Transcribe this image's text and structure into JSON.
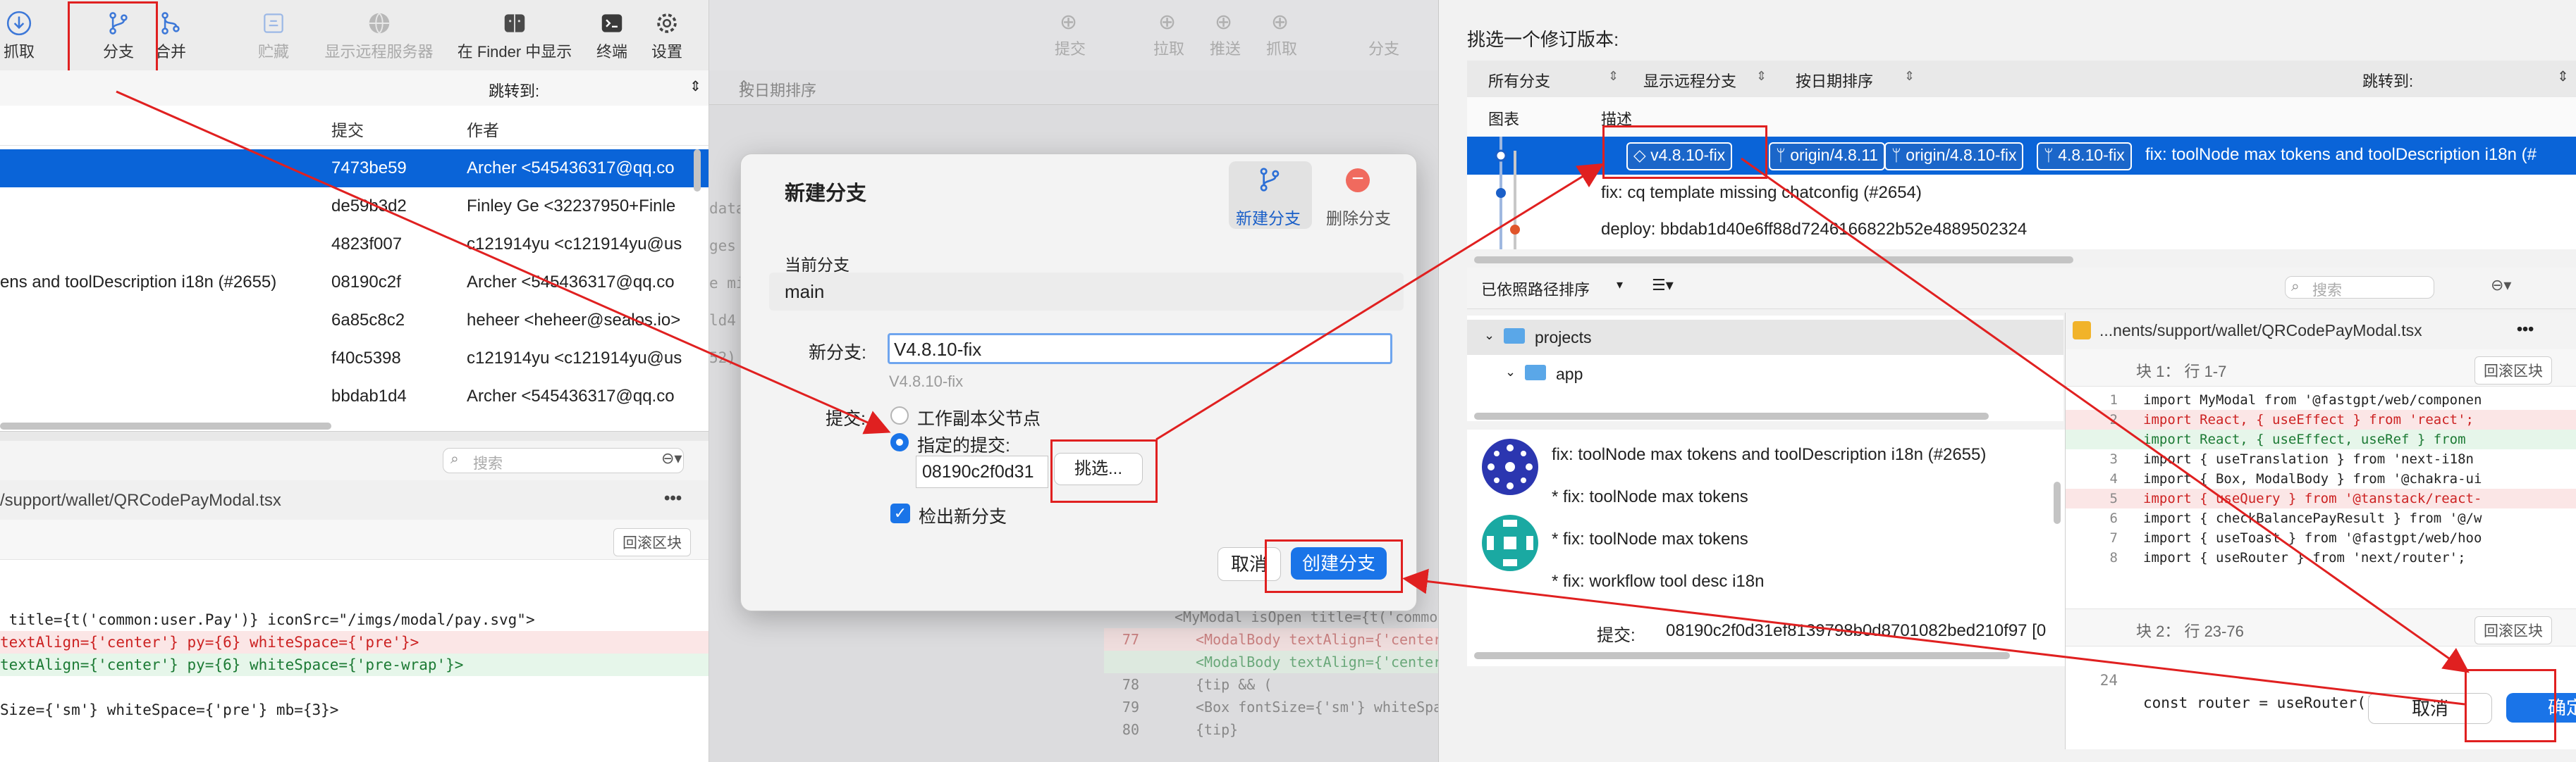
{
  "left_window": {
    "toolbar": [
      {
        "label": "抓取",
        "icon": "fetch-icon",
        "dim": false
      },
      {
        "label": "分支",
        "icon": "branch-icon",
        "dim": false
      },
      {
        "label": "合并",
        "icon": "merge-icon",
        "dim": false
      },
      {
        "label": "贮藏",
        "icon": "stash-icon",
        "dim": true
      },
      {
        "label": "显示远程服务器",
        "icon": "globe-icon",
        "dim": true
      },
      {
        "label": "在 Finder 中显示",
        "icon": "finder-icon",
        "dim": false
      },
      {
        "label": "终端",
        "icon": "terminal-icon",
        "dim": false
      },
      {
        "label": "设置",
        "icon": "gear-icon",
        "dim": false
      }
    ],
    "jump_to": "跳转到:",
    "columns": {
      "hash": "提交",
      "author": "作者"
    },
    "commits": [
      {
        "message": "",
        "hash": "7473be59",
        "author": "Archer <545436317@qq.co",
        "selected": true
      },
      {
        "message": "",
        "hash": "de59b3d2",
        "author": "Finley Ge <32237950+Finle",
        "selected": false
      },
      {
        "message": "",
        "hash": "4823f007",
        "author": "c121914yu <c121914yu@us",
        "selected": false
      },
      {
        "message": "ens and toolDescription i18n (#2655)",
        "hash": "08190c2f",
        "author": "Archer <545436317@qq.co",
        "selected": false
      },
      {
        "message": "",
        "hash": "6a85c8c2",
        "author": "heheer <heheer@sealos.io>",
        "selected": false
      },
      {
        "message": "",
        "hash": "f40c5398",
        "author": "c121914yu <c121914yu@us",
        "selected": false
      },
      {
        "message": "",
        "hash": "bbdab1d4",
        "author": "Archer <545436317@qq.co",
        "selected": false
      }
    ],
    "search_placeholder": "搜索",
    "file_path": "/support/wallet/QRCodePayModal.tsx",
    "more_label": "•••",
    "rollback_label": "回滚区块",
    "code_lines": [
      {
        "text": " title={t('common:user.Pay')} iconSrc=\"/imgs/modal/pay.svg\">",
        "kind": "ctx"
      },
      {
        "text": "textAlign={'center'} py={6} whiteSpace={'pre'}>",
        "kind": "del"
      },
      {
        "text": "textAlign={'center'} py={6} whiteSpace={'pre-wrap'}>",
        "kind": "add"
      },
      {
        "text": "",
        "kind": "ctx"
      },
      {
        "text": "Size={'sm'} whiteSpace={'pre'} mb={3}>",
        "kind": "ctx"
      }
    ]
  },
  "middle_window": {
    "toolbar": [
      "提交",
      "拉取",
      "推送",
      "抓取",
      "分支"
    ],
    "sort_label": "按日期排序",
    "frag": [
      "data",
      "ges",
      "e mi",
      "ld4",
      "52)"
    ],
    "code": [
      {
        "ln": "",
        "text": "<MyModal isOpen title={t('common:us",
        "kind": "ctx"
      },
      {
        "ln": "77",
        "text": "<ModalBody textAlign={'center'} py",
        "kind": "del"
      },
      {
        "ln": "",
        "text": "<ModalBody textAlign={'center'} py",
        "kind": "add"
      },
      {
        "ln": "78",
        "text": "{tip && (",
        "kind": "ctx"
      },
      {
        "ln": "79",
        "text": "<Box fontSize={'sm'} whiteSpa",
        "kind": "ctx"
      },
      {
        "ln": "80",
        "text": "{tip}",
        "kind": "ctx"
      }
    ]
  },
  "new_branch_dialog": {
    "title": "新建分支",
    "tab_new": "新建分支",
    "tab_delete": "删除分支",
    "current_branch_label": "当前分支",
    "current_branch": "main",
    "new_branch_label": "新分支:",
    "new_branch_value": "V4.8.10-fix",
    "new_branch_hint": "V4.8.10-fix",
    "commit_label": "提交:",
    "opt_working": "工作副本父节点",
    "opt_specified": "指定的提交:",
    "specified_commit": "08190c2f0d31",
    "pick_button": "挑选...",
    "checkout_label": "检出新分支",
    "checkout_checked": true,
    "cancel": "取消",
    "create": "创建分支"
  },
  "pick_dialog": {
    "title": "挑选一个修订版本:",
    "filter_branches": "所有分支",
    "filter_remote": "显示远程分支",
    "filter_sort": "按日期排序",
    "jump_to": "跳转到:",
    "col_graph": "图表",
    "col_desc": "描述",
    "tags": [
      "v4.8.10-fix",
      "origin/4.8.11",
      "origin/4.8.10-fix",
      "4.8.10-fix"
    ],
    "rows": [
      {
        "text": "fix: toolNode max tokens and toolDescription i18n (#",
        "selected": true
      },
      {
        "text": "fix: cq template missing chatconfig (#2654)",
        "selected": false
      },
      {
        "text": "deploy: bbdab1d40e6ff88d7246166822b52e4889502324",
        "selected": false
      }
    ],
    "path_sort": "已依照路径排序",
    "search_placeholder": "搜索",
    "tree": [
      {
        "name": "projects",
        "depth": 0
      },
      {
        "name": "app",
        "depth": 1
      }
    ],
    "file_title": "...nents/support/wallet/QRCodePayModal.tsx",
    "more": "•••",
    "hunk1_title": "块 1： 行 1-7",
    "hunk2_title": "块 2： 行 23-76",
    "rollback": "回滚区块",
    "diff": [
      {
        "ln": "1",
        "text": "import MyModal from '@fastgpt/web/componen",
        "kind": "ctx"
      },
      {
        "ln": "2",
        "text": "import React, { useEffect } from 'react';",
        "kind": "del"
      },
      {
        "ln": "",
        "text": "import React, { useEffect, useRef } from",
        "kind": "add"
      },
      {
        "ln": "3",
        "text": "import { useTranslation } from 'next-i18n",
        "kind": "ctx"
      },
      {
        "ln": "4",
        "text": "import { Box, ModalBody } from '@chakra-ui",
        "kind": "ctx"
      },
      {
        "ln": "5",
        "text": "import { useQuery } from '@tanstack/react-",
        "kind": "del"
      },
      {
        "ln": "6",
        "text": "import { checkBalancePayResult } from '@/w",
        "kind": "ctx"
      },
      {
        "ln": "7",
        "text": "import { useToast } from '@fastgpt/web/hoo",
        "kind": "ctx"
      },
      {
        "ln": "8",
        "text": "import { useRouter } from 'next/router';",
        "kind": "ctx"
      }
    ],
    "diff2": {
      "ln": "24",
      "text": "const router = useRouter();"
    },
    "commit_msgs": [
      "fix: toolNode max tokens and toolDescription i18n (#2655)",
      "* fix: toolNode max tokens",
      "* fix: toolNode max tokens",
      "* fix: workflow tool desc i18n"
    ],
    "commit_label": "提交:",
    "commit_hash": "08190c2f0d31ef8139798b0d8701082bed210f97 [0",
    "cancel": "取消",
    "confirm": "确定"
  }
}
